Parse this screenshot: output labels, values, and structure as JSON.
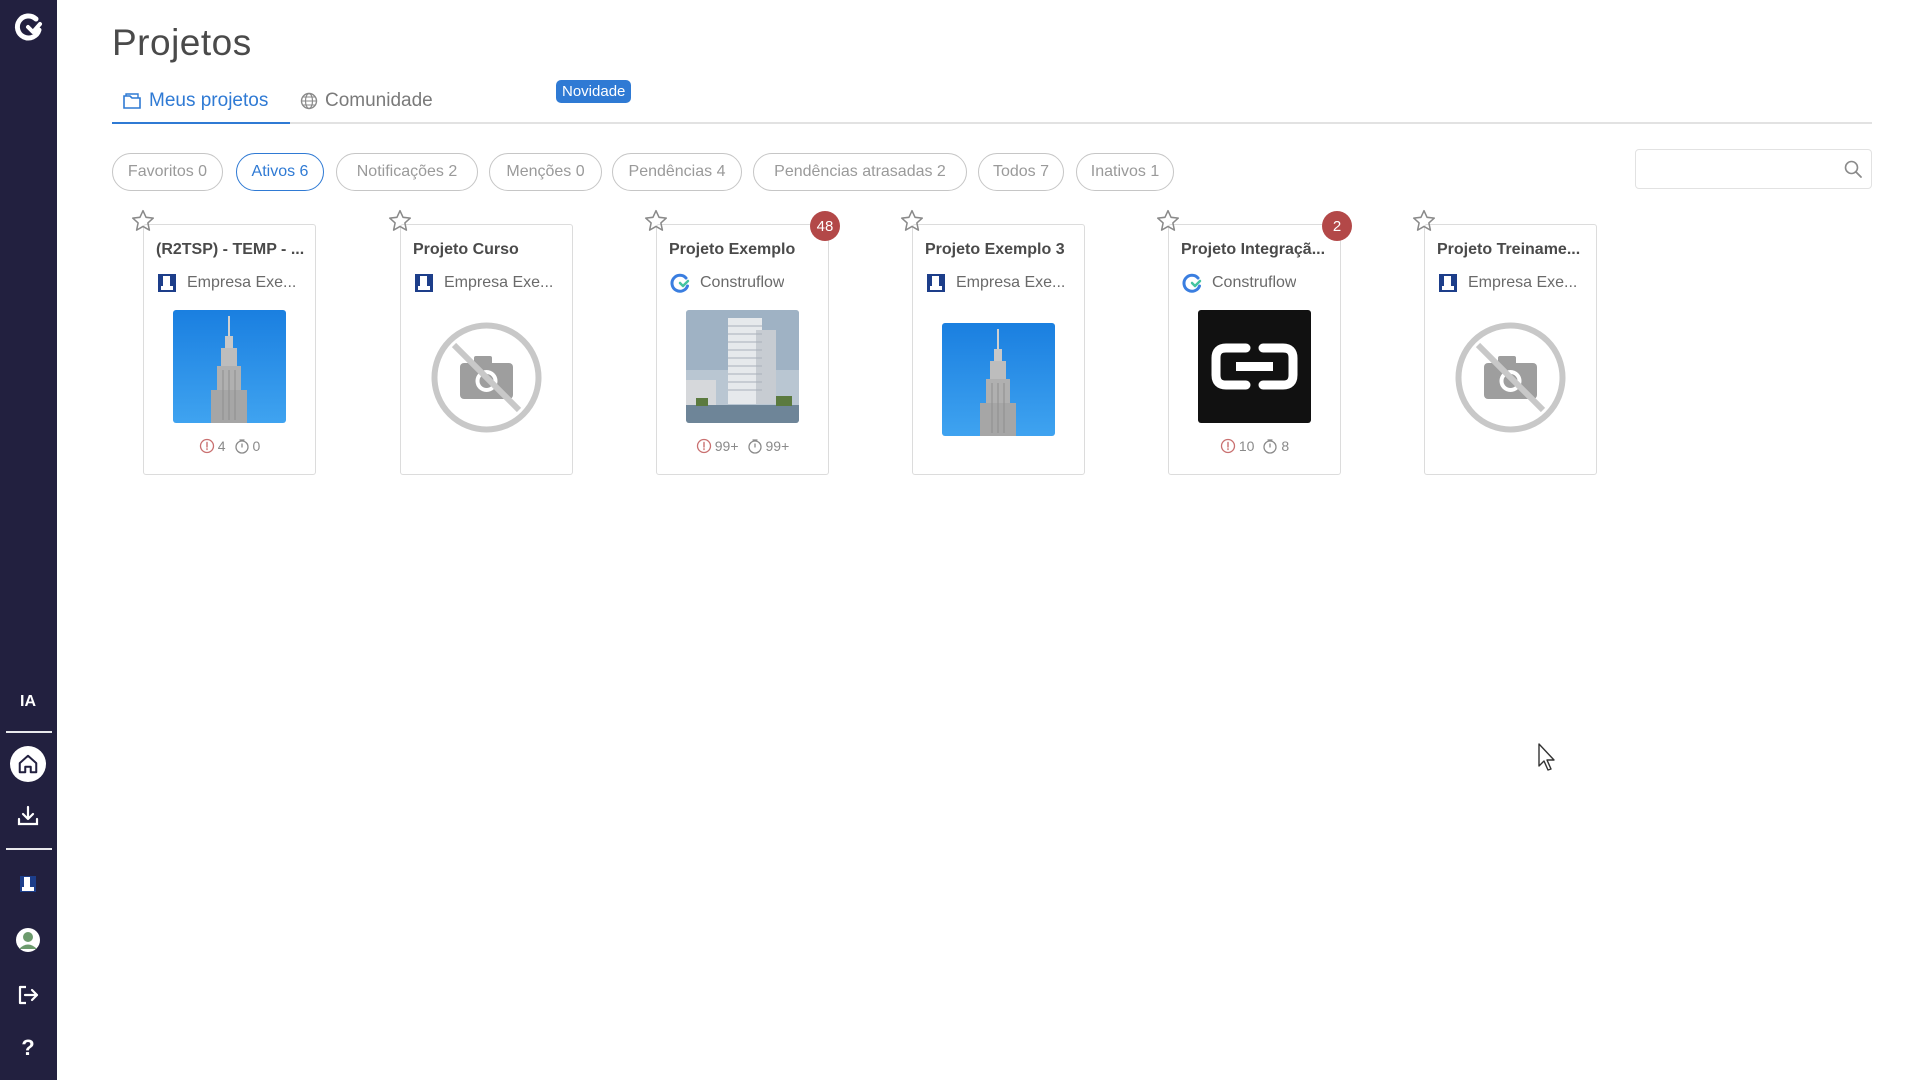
{
  "sidebar": {
    "ia_label": "IA",
    "bg_color": "#22203f"
  },
  "page": {
    "title": "Projetos"
  },
  "tabs": [
    {
      "label": "Meus projetos",
      "icon": "folder-icon",
      "active": true
    },
    {
      "label": "Comunidade",
      "icon": "globe-icon",
      "active": false
    }
  ],
  "novidade_badge": "Novidade",
  "filters": [
    {
      "label": "Favoritos 0",
      "active": false
    },
    {
      "label": "Ativos 6",
      "active": true
    },
    {
      "label": "Notificações 2",
      "active": false
    },
    {
      "label": "Menções 0",
      "active": false
    },
    {
      "label": "Pendências 4",
      "active": false
    },
    {
      "label": "Pendências atrasadas 2",
      "active": false
    },
    {
      "label": "Todos 7",
      "active": false
    },
    {
      "label": "Inativos 1",
      "active": false
    }
  ],
  "search": {
    "placeholder": "",
    "value": ""
  },
  "projects": [
    {
      "name": "(R2TSP) - TEMP - ...",
      "company": "Empresa Exe...",
      "company_icon": "building-icon",
      "image": "skyscraper",
      "badge": "",
      "stat_pending": "4",
      "stat_late": "0"
    },
    {
      "name": "Projeto Curso",
      "company": "Empresa Exe...",
      "company_icon": "building-icon",
      "image": "no-photo",
      "badge": "",
      "stat_pending": "",
      "stat_late": ""
    },
    {
      "name": "Projeto Exemplo",
      "company": "Construflow",
      "company_icon": "construflow-logo-icon",
      "image": "tower-render",
      "badge": "48",
      "stat_pending": "99+",
      "stat_late": "99+"
    },
    {
      "name": "Projeto Exemplo 3",
      "company": "Empresa Exe...",
      "company_icon": "building-icon",
      "image": "skyscraper",
      "badge": "",
      "stat_pending": "",
      "stat_late": ""
    },
    {
      "name": "Projeto Integraçã...",
      "company": "Construflow",
      "company_icon": "construflow-logo-icon",
      "image": "link-logo",
      "badge": "2",
      "stat_pending": "10",
      "stat_late": "8"
    },
    {
      "name": "Projeto Treiname...",
      "company": "Empresa Exe...",
      "company_icon": "building-icon",
      "image": "no-photo",
      "badge": "",
      "stat_pending": "",
      "stat_late": ""
    }
  ],
  "colors": {
    "accent": "#2f7ad4",
    "badge": "#b34848",
    "sidebar": "#22203f"
  }
}
